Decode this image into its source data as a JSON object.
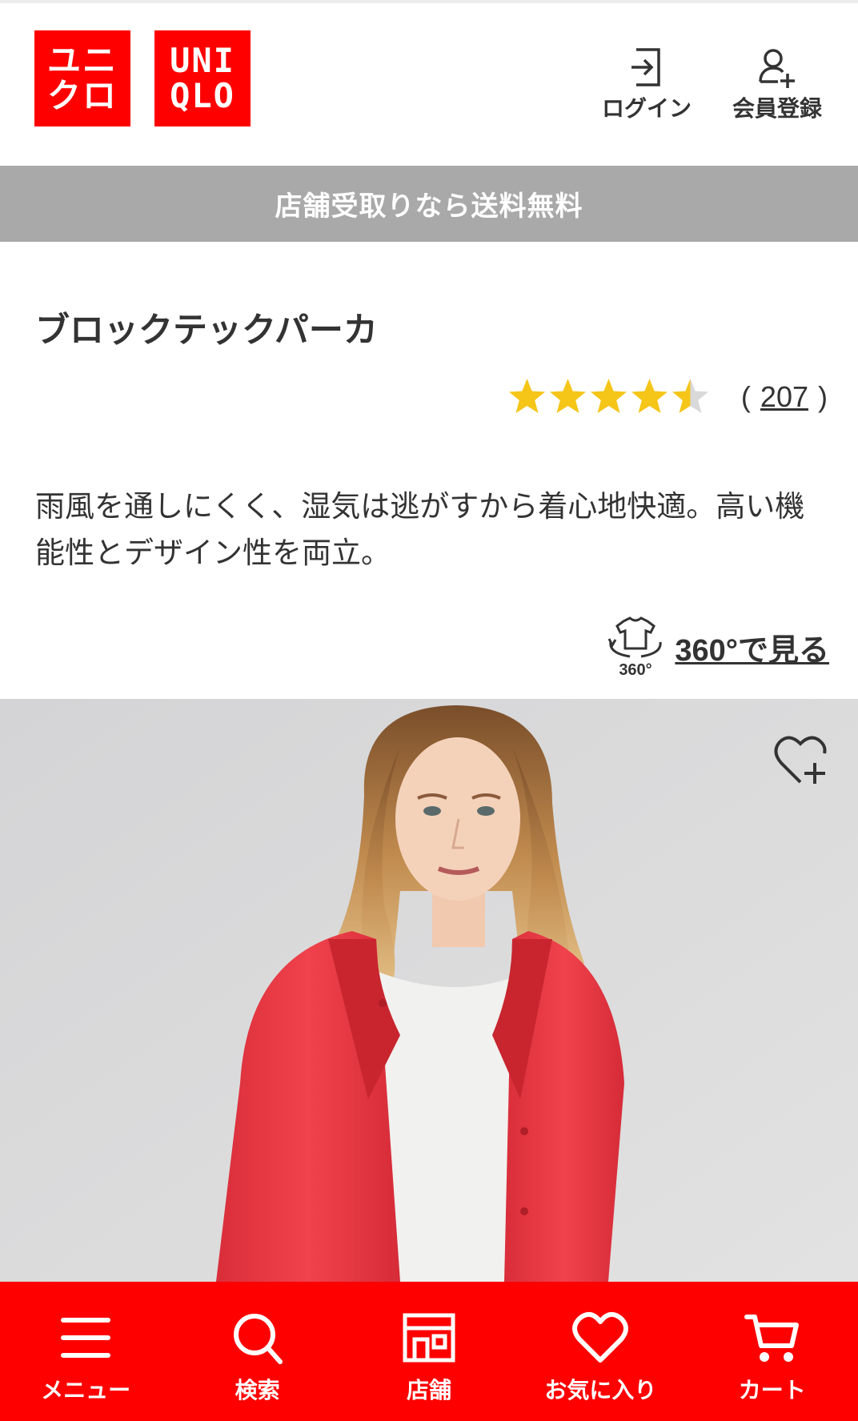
{
  "header": {
    "logo_katakana_line1": "ユニ",
    "logo_katakana_line2": "クロ",
    "logo_latin_line1": "UNI",
    "logo_latin_line2": "QLO",
    "login_label": "ログイン",
    "register_label": "会員登録"
  },
  "banner": {
    "text": "店舗受取りなら送料無料"
  },
  "product": {
    "title": "ブロックテックパーカ",
    "rating": 4.5,
    "rating_max": 5,
    "review_open": "(",
    "review_count": "207",
    "review_close": ")",
    "description": "雨風を通しにくく、湿気は逃がすから着心地快適。高い機能性とデザイン性を両立。",
    "view360_icon_text": "360°",
    "view360_label": "360°で見る"
  },
  "colors": {
    "brand_red": "#ff0000",
    "banner_gray": "#a9a9a9",
    "star_gold": "#f5c518",
    "star_empty": "#d9d9d9"
  },
  "bottom_nav": {
    "items": [
      {
        "label": "メニュー",
        "icon": "menu-icon"
      },
      {
        "label": "検索",
        "icon": "search-icon"
      },
      {
        "label": "店舗",
        "icon": "store-icon"
      },
      {
        "label": "お気に入り",
        "icon": "heart-icon"
      },
      {
        "label": "カート",
        "icon": "cart-icon"
      }
    ]
  }
}
